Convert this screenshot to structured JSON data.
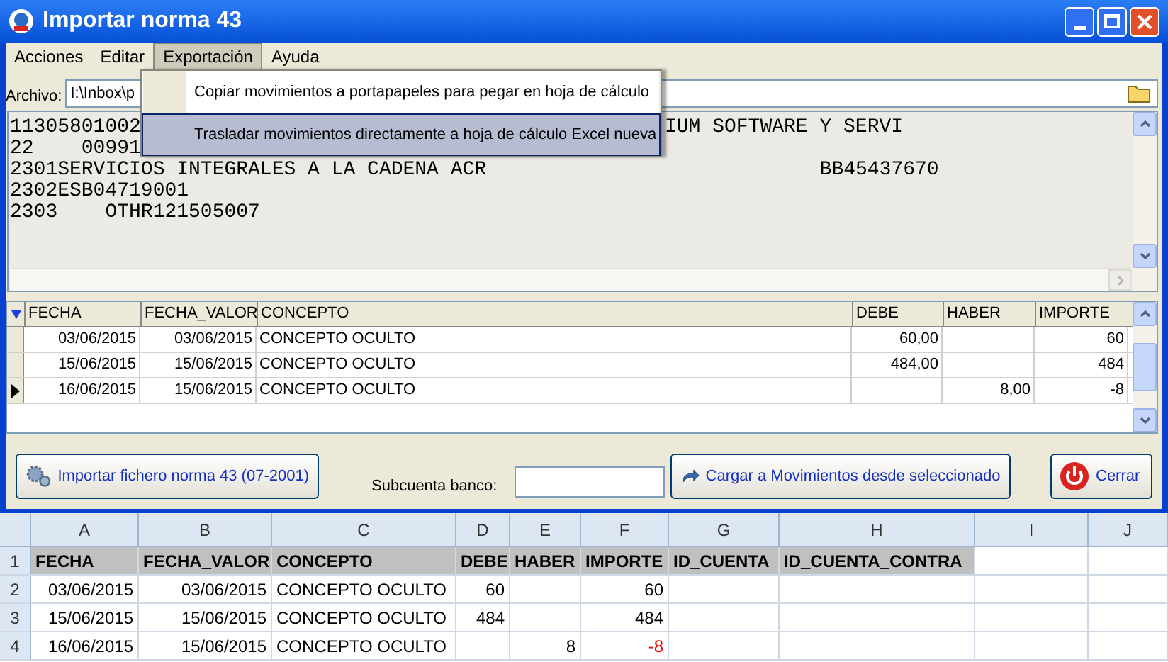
{
  "window": {
    "title": "Importar norma 43"
  },
  "menu_bar": [
    {
      "label": "Acciones",
      "selected": false
    },
    {
      "label": "Editar",
      "selected": false
    },
    {
      "label": "Exportación",
      "selected": true
    },
    {
      "label": "Ayuda",
      "selected": false
    }
  ],
  "dropdown": [
    {
      "label": "Copiar movimientos a portapapeles para pegar en hoja de cálculo",
      "selected": false
    },
    {
      "label": "Trasladar movimientos directamente a hoja de cálculo Excel nueva",
      "selected": true
    }
  ],
  "file_field": {
    "label": "Archivo:",
    "value": "I:\\Inbox\\p"
  },
  "text_lines": [
    {
      "segments": [
        "11305801002",
        "IUM SOFTWARE Y SERVI"
      ]
    },
    {
      "segments": [
        "22    00991"
      ]
    },
    {
      "segments": [
        "2301SERVICIOS INTEGRALES A LA CADENA ACR                            BB45437670"
      ]
    },
    {
      "segments": [
        "2302ESB04719001"
      ]
    },
    {
      "segments": [
        "2303    OTHR121505007"
      ]
    }
  ],
  "grid": {
    "columns": [
      "FECHA",
      "FECHA_VALOR",
      "CONCEPTO",
      "DEBE",
      "HABER",
      "IMPORTE"
    ],
    "rows": [
      {
        "selected": false,
        "cells": [
          "03/06/2015",
          "03/06/2015",
          "CONCEPTO OCULTO",
          "60,00",
          "",
          "60"
        ]
      },
      {
        "selected": false,
        "cells": [
          "15/06/2015",
          "15/06/2015",
          "CONCEPTO OCULTO",
          "484,00",
          "",
          "484"
        ]
      },
      {
        "selected": true,
        "cells": [
          "16/06/2015",
          "15/06/2015",
          "CONCEPTO OCULTO",
          "",
          "8,00",
          "-8"
        ]
      }
    ]
  },
  "buttons": {
    "import": "Importar fichero norma 43 (07-2001)",
    "subaccount_label": "Subcuenta banco:",
    "load": "Cargar a Movimientos desde seleccionado",
    "close": "Cerrar"
  },
  "sheet": {
    "columns": [
      "A",
      "B",
      "C",
      "D",
      "E",
      "F",
      "G",
      "H",
      "I",
      "J"
    ],
    "rows": [
      {
        "number": "1",
        "header": true,
        "cells": [
          "FECHA",
          "FECHA_VALOR",
          "CONCEPTO",
          "DEBE",
          "HABER",
          "IMPORTE",
          "ID_CUENTA",
          "ID_CUENTA_CONTRA",
          "",
          ""
        ],
        "negative": false
      },
      {
        "number": "2",
        "header": false,
        "cells": [
          "03/06/2015",
          "03/06/2015",
          "CONCEPTO OCULTO",
          "60",
          "",
          "60",
          "",
          "",
          "",
          ""
        ],
        "negative": false
      },
      {
        "number": "3",
        "header": false,
        "cells": [
          "15/06/2015",
          "15/06/2015",
          "CONCEPTO OCULTO",
          "484",
          "",
          "484",
          "",
          "",
          "",
          ""
        ],
        "negative": false
      },
      {
        "number": "4",
        "header": false,
        "cells": [
          "16/06/2015",
          "15/06/2015",
          "CONCEPTO OCULTO",
          "",
          "8",
          "-8",
          "",
          "",
          "",
          ""
        ],
        "negative": true
      }
    ]
  }
}
